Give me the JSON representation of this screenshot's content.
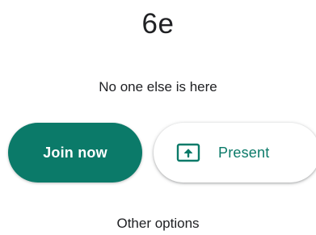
{
  "meeting": {
    "code": "6e",
    "status": "No one else is here"
  },
  "actions": {
    "join_label": "Join now",
    "present_label": "Present",
    "present_icon": "present-screen-icon",
    "other_options_label": "Other options"
  },
  "colors": {
    "accent": "#0b7a69",
    "text": "#202124",
    "background": "#ffffff"
  }
}
